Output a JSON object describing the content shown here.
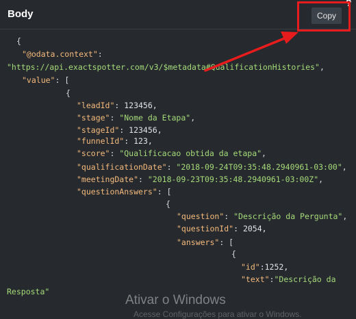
{
  "header": {
    "title": "Body",
    "copy_label": "Copy"
  },
  "code": {
    "l1": "{",
    "l2_key": "\"@odata.context\"",
    "l2_punct": ":",
    "l3_str": "\"https://api.exactspotter.com/v3/$metadata#QualificationHistories\"",
    "l3_punct": ",",
    "l4_key": "\"value\"",
    "l4_punct": ": [",
    "l5": "{",
    "l6_key": "\"leadId\"",
    "l6_val": ": 123456,",
    "l7_key": "\"stage\"",
    "l7_str": "\"Nome da Etapa\"",
    "l8_key": "\"stageId\"",
    "l8_val": ": 123456,",
    "l9_key": "\"funnelId\"",
    "l9_val": ": 123,",
    "l10_key": "\"score\"",
    "l10_str": "\"Qualificacao obtida da etapa\"",
    "l11_key": "\"qualificationDate\"",
    "l11_str": "\"2018-09-24T09:35:48.2940961-03:00\"",
    "l12_key": "\"meetingDate\"",
    "l12_str": "\"2018-09-23T09:35:48.2940961-03:00Z\"",
    "l13_key": "\"questionAnswers\"",
    "l13_punct": ": [",
    "l14": "{",
    "l15_key": "\"question\"",
    "l15_str": "\"Descrição da Pergunta\"",
    "l16_key": "\"questionId\"",
    "l16_val": ": 2054,",
    "l17_key": "\"answers\"",
    "l17_punct": ": [",
    "l18": "{",
    "l19_key": "\"id\"",
    "l19_val": ":1252,",
    "l20_key": "\"text\"",
    "l20_str": "\"Descrição da",
    "l21_str": "Resposta\""
  },
  "watermark": {
    "title": "Ativar o Windows",
    "subtitle": "Acesse Configurações para ativar o Windows."
  },
  "colors": {
    "arrow": "#e81c1c",
    "key": "#f5ba7c",
    "string": "#a6db79"
  }
}
